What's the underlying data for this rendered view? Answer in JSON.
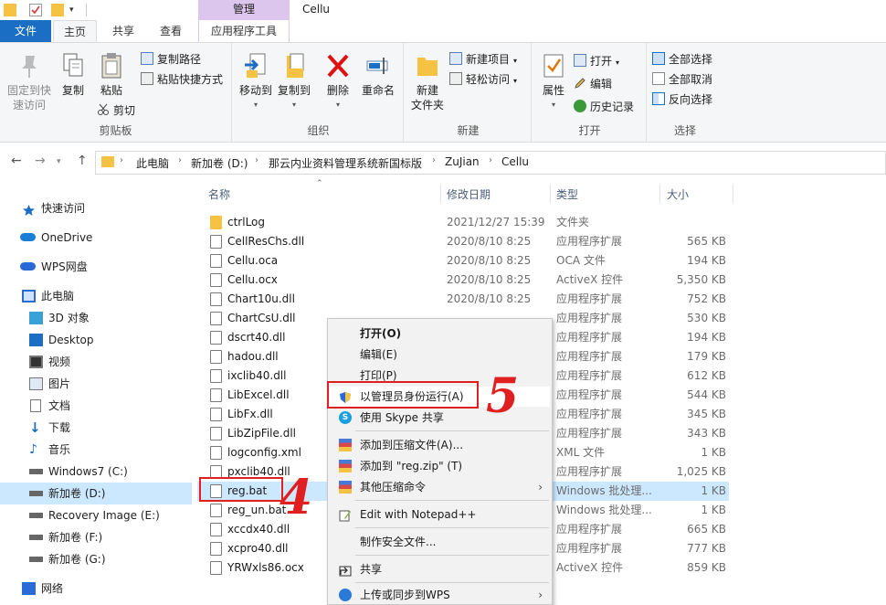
{
  "window": {
    "title": "Cellu",
    "context_tab_header": "管理"
  },
  "tabs": {
    "file": "文件",
    "home": "主页",
    "share": "共享",
    "view": "查看",
    "apptools": "应用程序工具"
  },
  "ribbon": {
    "clipboard": {
      "pin_line1": "固定到快",
      "pin_line2": "速访问",
      "copy": "复制",
      "paste": "粘贴",
      "copy_path": "复制路径",
      "paste_shortcut": "粘贴快捷方式",
      "cut": "剪切",
      "label": "剪贴板"
    },
    "organize": {
      "move_to": "移动到",
      "copy_to": "复制到",
      "delete": "删除",
      "rename": "重命名",
      "label": "组织"
    },
    "new": {
      "new_folder_line1": "新建",
      "new_folder_line2": "文件夹",
      "new_item": "新建项目",
      "easy_access": "轻松访问",
      "label": "新建"
    },
    "open": {
      "properties": "属性",
      "open": "打开",
      "edit": "编辑",
      "history": "历史记录",
      "label": "打开"
    },
    "select": {
      "select_all": "全部选择",
      "select_none": "全部取消",
      "invert": "反向选择",
      "label": "选择"
    }
  },
  "address": {
    "crumbs": [
      "此电脑",
      "新加卷 (D:)",
      "那云内业资料管理系统新国标版",
      "ZuJian",
      "Cellu"
    ]
  },
  "nav": {
    "items": [
      {
        "label": "快速访问"
      },
      {
        "label": "OneDrive"
      },
      {
        "label": "WPS网盘"
      },
      {
        "label": "此电脑"
      },
      {
        "label": "3D 对象"
      },
      {
        "label": "Desktop"
      },
      {
        "label": "视频"
      },
      {
        "label": "图片"
      },
      {
        "label": "文档"
      },
      {
        "label": "下载"
      },
      {
        "label": "音乐"
      },
      {
        "label": "Windows7 (C:)"
      },
      {
        "label": "新加卷 (D:)"
      },
      {
        "label": "Recovery Image (E:)"
      },
      {
        "label": "新加卷 (F:)"
      },
      {
        "label": "新加卷 (G:)"
      },
      {
        "label": "网络"
      }
    ]
  },
  "columns": {
    "name": "名称",
    "date": "修改日期",
    "type": "类型",
    "size": "大小"
  },
  "files": [
    {
      "name": "ctrlLog",
      "date": "2021/12/27 15:39",
      "type": "文件夹",
      "size": ""
    },
    {
      "name": "CellResChs.dll",
      "date": "2020/8/10 8:25",
      "type": "应用程序扩展",
      "size": "565 KB"
    },
    {
      "name": "Cellu.oca",
      "date": "2020/8/10 8:25",
      "type": "OCA 文件",
      "size": "194 KB"
    },
    {
      "name": "Cellu.ocx",
      "date": "2020/8/10 8:25",
      "type": "ActiveX 控件",
      "size": "5,350 KB"
    },
    {
      "name": "Chart10u.dll",
      "date": "2020/8/10 8:25",
      "type": "应用程序扩展",
      "size": "752 KB"
    },
    {
      "name": "ChartCsU.dll",
      "date": "",
      "type": "应用程序扩展",
      "size": "530 KB"
    },
    {
      "name": "dscrt40.dll",
      "date": "",
      "type": "应用程序扩展",
      "size": "194 KB"
    },
    {
      "name": "hadou.dll",
      "date": "",
      "type": "应用程序扩展",
      "size": "179 KB"
    },
    {
      "name": "ixclib40.dll",
      "date": "",
      "type": "应用程序扩展",
      "size": "612 KB"
    },
    {
      "name": "LibExcel.dll",
      "date": "",
      "type": "应用程序扩展",
      "size": "544 KB"
    },
    {
      "name": "LibFx.dll",
      "date": "",
      "type": "应用程序扩展",
      "size": "345 KB"
    },
    {
      "name": "LibZipFile.dll",
      "date": "",
      "type": "应用程序扩展",
      "size": "343 KB"
    },
    {
      "name": "logconfig.xml",
      "date": "",
      "type": "XML 文件",
      "size": "1 KB"
    },
    {
      "name": "pxclib40.dll",
      "date": "",
      "type": "应用程序扩展",
      "size": "1,025 KB"
    },
    {
      "name": "reg.bat",
      "date": "",
      "type": "Windows 批处理...",
      "size": "1 KB"
    },
    {
      "name": "reg_un.bat",
      "date": "",
      "type": "Windows 批处理...",
      "size": "1 KB"
    },
    {
      "name": "xccdx40.dll",
      "date": "",
      "type": "应用程序扩展",
      "size": "665 KB"
    },
    {
      "name": "xcpro40.dll",
      "date": "",
      "type": "应用程序扩展",
      "size": "777 KB"
    },
    {
      "name": "YRWxls86.ocx",
      "date": "",
      "type": "ActiveX 控件",
      "size": "859 KB"
    }
  ],
  "context_menu": {
    "open": "打开(O)",
    "edit": "编辑(E)",
    "print": "打印(P)",
    "run_as_admin": "以管理员身份运行(A)",
    "skype": "使用 Skype 共享",
    "add_archive": "添加到压缩文件(A)...",
    "add_zip": "添加到 \"reg.zip\" (T)",
    "other_compress": "其他压缩命令",
    "notepad": "Edit with Notepad++",
    "secure_file": "制作安全文件...",
    "share": "共享",
    "wps_sync": "上传或同步到WPS"
  },
  "annotations": {
    "step4": "4",
    "step5": "5"
  },
  "colors": {
    "accent": "#1a6fc4",
    "selection": "#cce8ff",
    "annotation": "#e02020",
    "context_tab": "#dcc6ee"
  }
}
